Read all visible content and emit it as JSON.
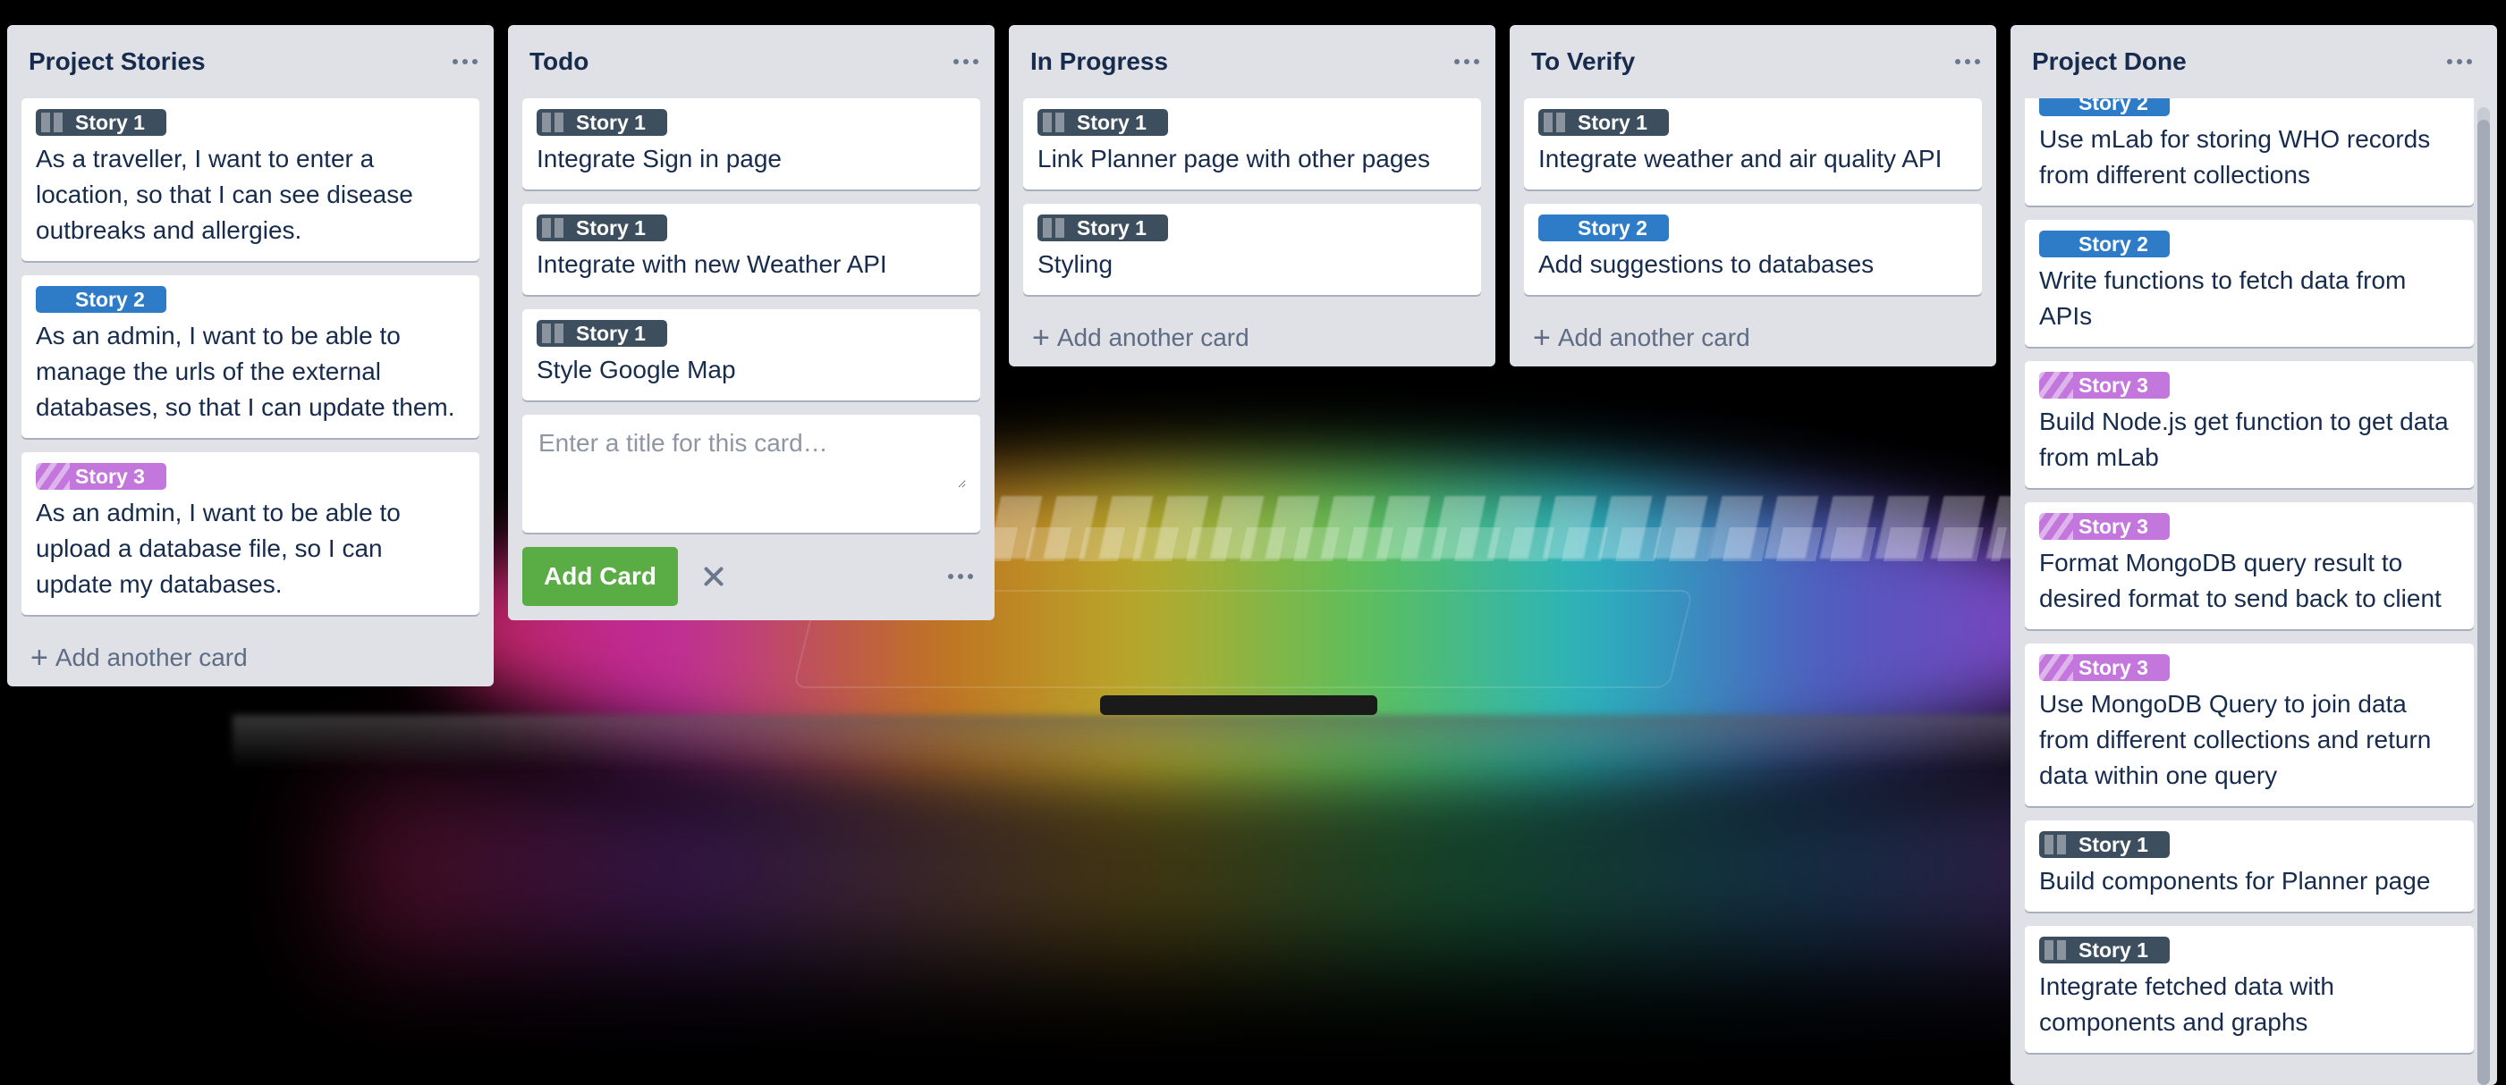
{
  "lists": [
    {
      "title": "Project Stories",
      "cards": [
        {
          "label": "Story 1",
          "label_class": "s1",
          "title": "As a traveller, I want to enter a location, so that I can see disease outbreaks and allergies."
        },
        {
          "label": "Story 2",
          "label_class": "s2",
          "title": "As an admin, I want to be able to manage the urls of the external databases, so that I can update them."
        },
        {
          "label": "Story 3",
          "label_class": "s3",
          "title": "As an admin, I want to be able to upload a database file, so I can update my databases."
        }
      ],
      "add_card": "Add another card"
    },
    {
      "title": "Todo",
      "cards": [
        {
          "label": "Story 1",
          "label_class": "s1",
          "title": "Integrate Sign in page"
        },
        {
          "label": "Story 1",
          "label_class": "s1",
          "title": "Integrate with new Weather API"
        },
        {
          "label": "Story 1",
          "label_class": "s1",
          "title": "Style Google Map"
        }
      ],
      "composer": {
        "placeholder": "Enter a title for this card…",
        "add_button": "Add Card"
      }
    },
    {
      "title": "In Progress",
      "cards": [
        {
          "label": "Story 1",
          "label_class": "s1",
          "title": "Link Planner page with other pages"
        },
        {
          "label": "Story 1",
          "label_class": "s1",
          "title": "Styling"
        }
      ],
      "add_card": "Add another card"
    },
    {
      "title": "To Verify",
      "cards": [
        {
          "label": "Story 1",
          "label_class": "s1",
          "title": "Integrate weather and air quality API"
        },
        {
          "label": "Story 2",
          "label_class": "s2",
          "title": "Add suggestions to databases"
        }
      ],
      "add_card": "Add another card"
    },
    {
      "title": "Project Done",
      "cards": [
        {
          "label": "Story 2",
          "label_class": "s2",
          "title": "Use mLab for storing WHO records from different collections"
        },
        {
          "label": "Story 2",
          "label_class": "s2",
          "title": "Write functions to fetch data from APIs"
        },
        {
          "label": "Story 3",
          "label_class": "s3",
          "title": "Build Node.js get function to get data from mLab"
        },
        {
          "label": "Story 3",
          "label_class": "s3",
          "title": "Format MongoDB query result to desired format to send back to client"
        },
        {
          "label": "Story 3",
          "label_class": "s3",
          "title": "Use MongoDB Query to join data from different collections and return data within one query"
        },
        {
          "label": "Story 1",
          "label_class": "s1",
          "title": "Build components for Planner page"
        },
        {
          "label": "Story 1",
          "label_class": "s1",
          "title": "Integrate fetched data with components and graphs"
        }
      ]
    }
  ],
  "colors": {
    "list_bg": "#dfe1e6",
    "story1": "#3d4f5e",
    "story2": "#2e7cc8",
    "story3": "#c376dc",
    "add_button": "#5aac44"
  },
  "icons": {
    "list_menu": "more-horizontal-icon",
    "add": "plus-icon",
    "close": "close-icon"
  }
}
